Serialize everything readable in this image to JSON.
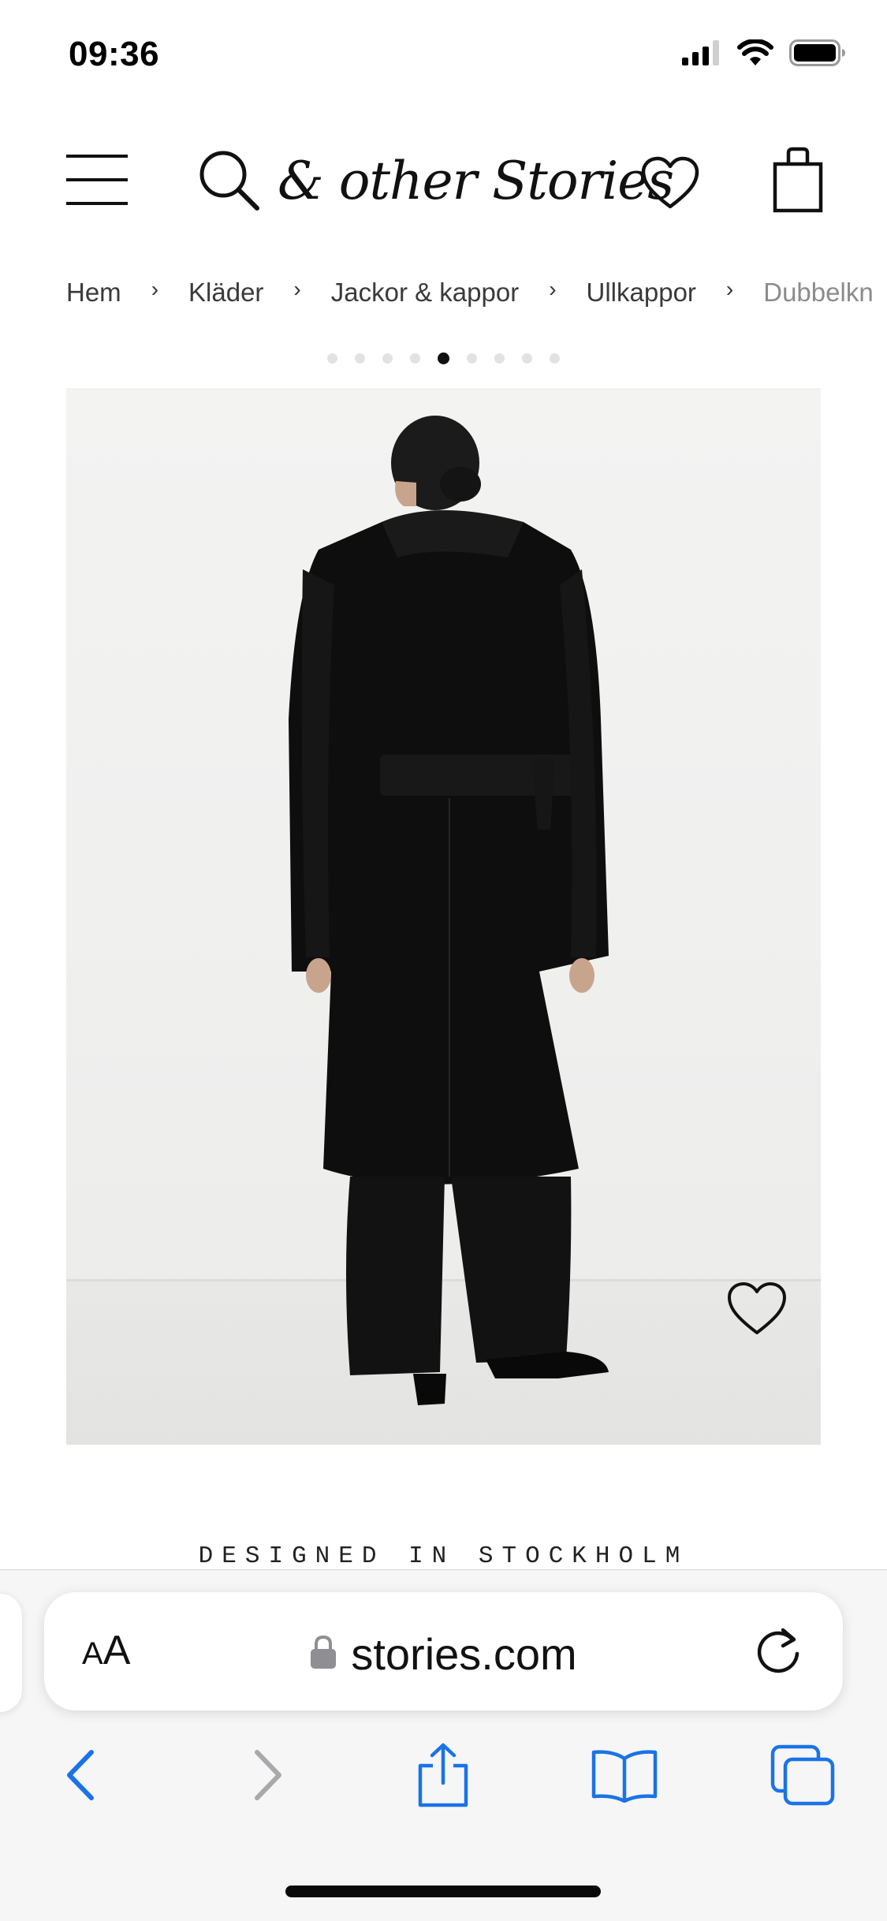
{
  "status_bar": {
    "time": "09:36",
    "signal_icon": "cellular-signal-icon",
    "wifi_icon": "wifi-icon",
    "battery_icon": "battery-icon"
  },
  "header": {
    "menu_icon": "hamburger-menu-icon",
    "search_icon": "search-icon",
    "logo_text": "& other Stories",
    "wishlist_icon": "heart-icon",
    "bag_icon": "shopping-bag-icon"
  },
  "breadcrumb": {
    "items": [
      {
        "label": "Hem"
      },
      {
        "label": "Kläder"
      },
      {
        "label": "Jackor & kappor"
      },
      {
        "label": "Ullkappor"
      },
      {
        "label": "Dubbelkn"
      }
    ],
    "separator": "›"
  },
  "carousel": {
    "dot_count": 9,
    "active_index": 4
  },
  "product": {
    "image_wishlist_icon": "heart-icon",
    "tagline": "DESIGNED IN STOCKHOLM"
  },
  "browser": {
    "text_size_label_small": "A",
    "text_size_label_large": "A",
    "lock_icon": "lock-icon",
    "url": "stories.com",
    "reload_icon": "reload-icon",
    "toolbar": {
      "back_icon": "back-chevron-icon",
      "forward_icon": "forward-chevron-icon",
      "share_icon": "share-icon",
      "bookmarks_icon": "bookmarks-icon",
      "tabs_icon": "tabs-icon"
    }
  },
  "colors": {
    "accent": "#1a73e8",
    "disabled": "#a9a9ad",
    "text": "#111111"
  }
}
